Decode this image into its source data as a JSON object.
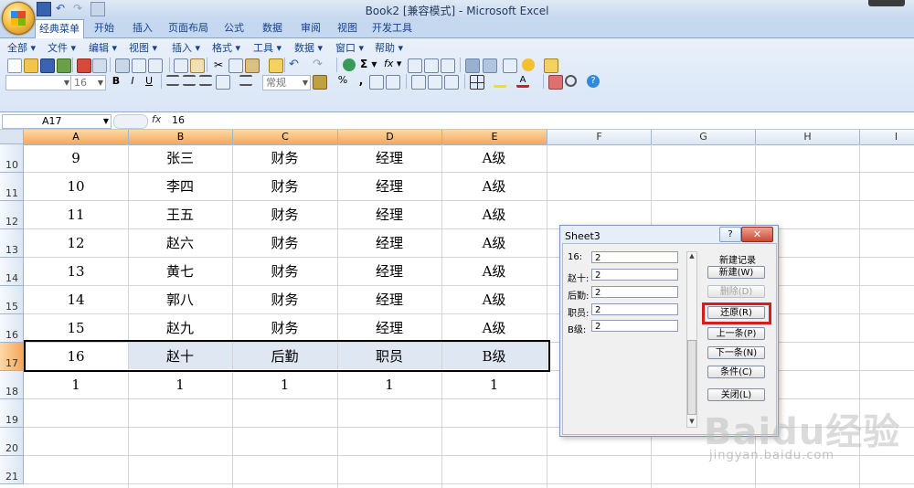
{
  "window": {
    "title": "Book2  [兼容模式] - Microsoft Excel"
  },
  "tabs": [
    {
      "label": "经典菜单",
      "active": true
    },
    {
      "label": "开始"
    },
    {
      "label": "插入"
    },
    {
      "label": "页面布局"
    },
    {
      "label": "公式"
    },
    {
      "label": "数据"
    },
    {
      "label": "审阅"
    },
    {
      "label": "视图"
    },
    {
      "label": "开发工具"
    }
  ],
  "menubar": [
    {
      "label": "全部 ▾"
    },
    {
      "label": "文件 ▾"
    },
    {
      "label": "编辑 ▾"
    },
    {
      "label": "视图 ▾"
    },
    {
      "label": "插入 ▾"
    },
    {
      "label": "格式 ▾"
    },
    {
      "label": "工具 ▾"
    },
    {
      "label": "数据 ▾"
    },
    {
      "label": "窗口 ▾"
    },
    {
      "label": "帮助 ▾"
    }
  ],
  "toolbar": {
    "font_size": "16",
    "number_format": "常规",
    "percent": "%",
    "comma": ",",
    "sigma": "Σ ▾",
    "fx": "fx ▾"
  },
  "formula_bar": {
    "name_box": "A17",
    "fx": "fx",
    "value": "16"
  },
  "columns": [
    "A",
    "B",
    "C",
    "D",
    "E",
    "F",
    "G",
    "H",
    "I"
  ],
  "rows": [
    {
      "num": "10",
      "cells": [
        "9",
        "张三",
        "财务",
        "经理",
        "A级"
      ]
    },
    {
      "num": "11",
      "cells": [
        "10",
        "李四",
        "财务",
        "经理",
        "A级"
      ]
    },
    {
      "num": "12",
      "cells": [
        "11",
        "王五",
        "财务",
        "经理",
        "A级"
      ]
    },
    {
      "num": "13",
      "cells": [
        "12",
        "赵六",
        "财务",
        "经理",
        "A级"
      ]
    },
    {
      "num": "14",
      "cells": [
        "13",
        "黄七",
        "财务",
        "经理",
        "A级"
      ]
    },
    {
      "num": "15",
      "cells": [
        "14",
        "郭八",
        "财务",
        "经理",
        "A级"
      ]
    },
    {
      "num": "16",
      "cells": [
        "15",
        "赵九",
        "财务",
        "经理",
        "A级"
      ]
    },
    {
      "num": "17",
      "cells": [
        "16",
        "赵十",
        "后勤",
        "职员",
        "B级"
      ],
      "selected": true
    },
    {
      "num": "18",
      "cells": [
        "1",
        "1",
        "1",
        "1",
        "1"
      ]
    },
    {
      "num": "19",
      "cells": [
        "",
        "",
        "",
        "",
        ""
      ]
    },
    {
      "num": "20",
      "cells": [
        "",
        "",
        "",
        "",
        ""
      ]
    },
    {
      "num": "21",
      "cells": [
        "",
        "",
        "",
        "",
        ""
      ]
    }
  ],
  "dialog": {
    "title": "Sheet3",
    "help": "?",
    "close": "✕",
    "status": "新建记录",
    "fields": [
      {
        "label": "16:",
        "value": "2"
      },
      {
        "label": "赵十:",
        "value": "2"
      },
      {
        "label": "后勤:",
        "value": "2"
      },
      {
        "label": "职员:",
        "value": "2"
      },
      {
        "label": "B级:",
        "value": "2"
      }
    ],
    "buttons": [
      {
        "label": "新建(W)",
        "disabled": false
      },
      {
        "label": "删除(D)",
        "disabled": true
      },
      {
        "label": "还原(R)",
        "disabled": false,
        "highlighted": true
      },
      {
        "label": "上一条(P)",
        "disabled": false
      },
      {
        "label": "下一条(N)",
        "disabled": false
      },
      {
        "label": "条件(C)",
        "disabled": false
      },
      {
        "label": "关闭(L)",
        "disabled": false
      }
    ]
  },
  "watermark": {
    "main": "Baidu经验",
    "sub": "jingyan.baidu.com"
  }
}
